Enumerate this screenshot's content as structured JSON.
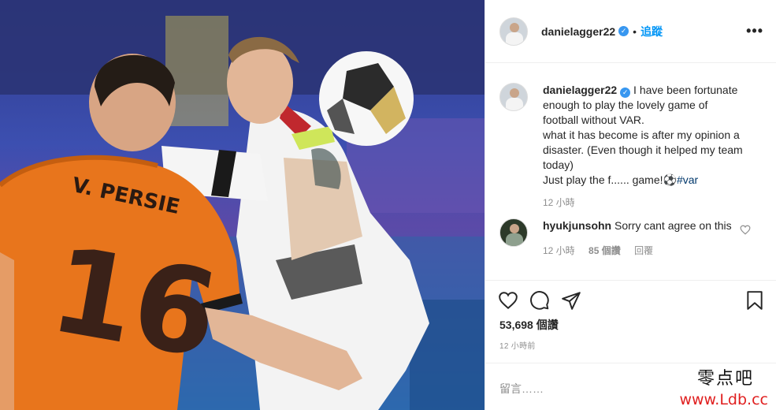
{
  "post": {
    "username": "danielagger22",
    "follow_label": "追蹤",
    "more_label": "•••"
  },
  "photo": {
    "jersey_name": "V. PERSIE",
    "jersey_number": "16"
  },
  "caption": {
    "username": "danielagger22",
    "lines": [
      "I have been fortunate enough to play the lovely game of football without VAR.",
      "what it has become is after my opinion a disaster. (Even though it helped my team today)",
      "Just play the f...... game!⚽"
    ],
    "hashtag": "#var",
    "time": "12 小時"
  },
  "reply": {
    "username": "hyukjunsohn",
    "text": "Sorry cant agree on this",
    "time": "12 小時",
    "likes": "85 個讚",
    "reply_label": "回覆"
  },
  "likes_count": "53,698 個讚",
  "posted_time": "12 小時前",
  "comment_placeholder": "留言……",
  "watermark": {
    "chinese": "零点吧",
    "url": "www.Ldb.cc"
  },
  "icons": [
    "verified-badge-icon",
    "heart-icon",
    "comment-icon",
    "share-icon",
    "bookmark-icon",
    "more-options-icon"
  ],
  "colors": {
    "link": "#0095f6",
    "verified": "#3897f0",
    "hashtag": "#00376b",
    "watermark_url": "#e02020"
  }
}
